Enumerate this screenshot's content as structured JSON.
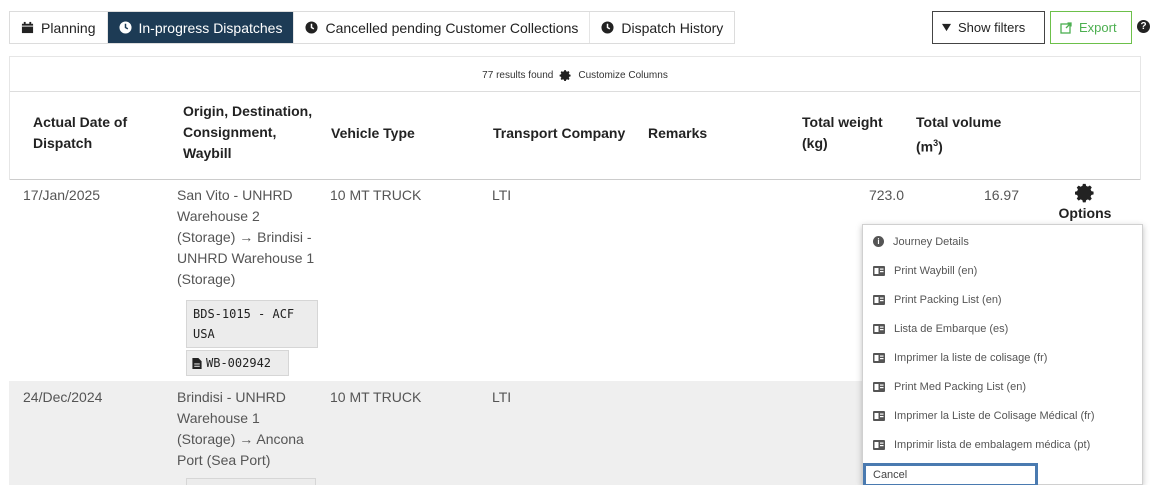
{
  "tabs": [
    {
      "label": "Planning",
      "icon": "calendar-icon",
      "active": false
    },
    {
      "label": "In-progress Dispatches",
      "icon": "clock-icon",
      "active": true
    },
    {
      "label": "Cancelled pending Customer Collections",
      "icon": "clock-icon",
      "active": false
    },
    {
      "label": "Dispatch History",
      "icon": "clock-icon",
      "active": false
    }
  ],
  "toolbar": {
    "show_filters": "Show filters",
    "export": "Export",
    "help": "?"
  },
  "results": {
    "count_text": "77 results found",
    "customize": "Customize Columns"
  },
  "columns": {
    "date": [
      "Actual Date of",
      "Dispatch"
    ],
    "origin": [
      "Origin, Destination,",
      "Consignment,",
      "Waybill"
    ],
    "vehicle": "Vehicle Type",
    "transport": "Transport Company",
    "remarks": "Remarks",
    "weight": [
      "Total weight",
      "(kg)"
    ],
    "volume_label": "Total volume",
    "volume_unit_prefix": "(m",
    "volume_unit_sup": "3",
    "volume_unit_suffix": ")"
  },
  "rows": [
    {
      "date": "17/Jan/2025",
      "route": [
        "San Vito - UNHRD",
        "Warehouse 2",
        "(Storage) → Brindisi -",
        "UNHRD Warehouse 1",
        "(Storage)"
      ],
      "consignment": [
        "BDS-1015 - ACF",
        "USA"
      ],
      "waybill": "WB-002942",
      "vehicle": "10 MT TRUCK",
      "transport": "LTI",
      "remarks": "",
      "weight": "723.0",
      "volume": "16.97",
      "options_label": "Options"
    },
    {
      "date": "24/Dec/2024",
      "route": [
        "Brindisi - UNHRD",
        "Warehouse 1",
        "(Storage) → Ancona",
        "Port (Sea Port)"
      ],
      "vehicle": "10 MT TRUCK",
      "transport": "LTI"
    }
  ],
  "menu": [
    {
      "label": "Journey Details",
      "icon": "info-icon"
    },
    {
      "label": "Print Waybill (en)",
      "icon": "id-card-icon"
    },
    {
      "label": "Print Packing List (en)",
      "icon": "id-card-icon"
    },
    {
      "label": "Lista de Embarque (es)",
      "icon": "id-card-icon"
    },
    {
      "label": "Imprimer la liste de colisage (fr)",
      "icon": "id-card-icon"
    },
    {
      "label": "Print Med Packing List (en)",
      "icon": "id-card-icon"
    },
    {
      "label": "Imprimer la Liste de Colisage Médical (fr)",
      "icon": "id-card-icon"
    },
    {
      "label": "Imprimir lista de embalagem médica (pt)",
      "icon": "id-card-icon"
    },
    {
      "label": "Cancel",
      "icon": ""
    }
  ],
  "colors": {
    "active_tab": "#1d3b55",
    "export_green": "#4caf50",
    "focus_border": "#4a7ab0"
  }
}
